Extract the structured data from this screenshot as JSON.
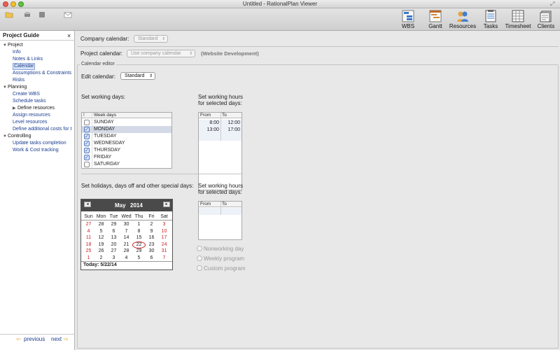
{
  "window": {
    "title": "Untitled - RationalPlan Viewer"
  },
  "colors": {
    "accent_red": "#c81e1e",
    "link_blue": "#1a3d8f",
    "check_blue": "#1b4fb6",
    "calendar_header": "#4a4a4a"
  },
  "toolbar": {
    "small_icons": [
      "folder-open-icon",
      "print-icon",
      "settings-icon",
      "email-icon"
    ],
    "views": [
      {
        "label": "WBS",
        "icon": "wbs-icon"
      },
      {
        "label": "Gantt",
        "icon": "gantt-icon"
      },
      {
        "label": "Resources",
        "icon": "resources-icon"
      },
      {
        "label": "Tasks",
        "icon": "tasks-icon"
      },
      {
        "label": "Timesheet",
        "icon": "timesheet-icon"
      },
      {
        "label": "Clients",
        "icon": "clients-icon"
      }
    ]
  },
  "guide": {
    "title": "Project Guide",
    "close": "×",
    "items": [
      {
        "label": "Project",
        "kind": "group",
        "expanded": true
      },
      {
        "label": "Info",
        "kind": "link"
      },
      {
        "label": "Notes & Links",
        "kind": "link"
      },
      {
        "label": "Calendar",
        "kind": "link",
        "selected": true
      },
      {
        "label": "Assumptions & Constraints",
        "kind": "link"
      },
      {
        "label": "Risks",
        "kind": "link"
      },
      {
        "label": "Planning",
        "kind": "group",
        "expanded": true
      },
      {
        "label": "Create WBS",
        "kind": "link"
      },
      {
        "label": "Schedule tasks",
        "kind": "link"
      },
      {
        "label": "Define resources",
        "kind": "subgroup",
        "expanded": false
      },
      {
        "label": "Assign resources",
        "kind": "link"
      },
      {
        "label": "Level resources",
        "kind": "link"
      },
      {
        "label": "Define additional costs for t",
        "kind": "link"
      },
      {
        "label": "Controlling",
        "kind": "group",
        "expanded": true
      },
      {
        "label": "Update tasks completion",
        "kind": "link"
      },
      {
        "label": "Work & Cost tracking",
        "kind": "link"
      }
    ],
    "previous": "previous",
    "next": "next"
  },
  "company_calendar": {
    "label": "Company calendar:",
    "value": "Standard"
  },
  "project_calendar": {
    "label": "Project calendar:",
    "value": "Use company calendar",
    "project_name": "(Website Development)"
  },
  "editor": {
    "group_label": "Calendar editor",
    "edit_label": "Edit calendar:",
    "edit_value": "Standard",
    "working_days_label": "Set working days:",
    "hours_label_1": "Set working hours",
    "hours_label_2": "for selected days:",
    "week_header_check": "!",
    "week_header_days": "Week days",
    "days": [
      {
        "name": "SUNDAY",
        "checked": false
      },
      {
        "name": "MONDAY",
        "checked": true,
        "selected": true
      },
      {
        "name": "TUESDAY",
        "checked": true
      },
      {
        "name": "WEDNESDAY",
        "checked": true
      },
      {
        "name": "THURSDAY",
        "checked": true
      },
      {
        "name": "FRIDAY",
        "checked": true
      },
      {
        "name": "SATURDAY",
        "checked": false
      }
    ],
    "hours_header_from": "From",
    "hours_header_to": "To",
    "hours": [
      {
        "from": "8:00",
        "to": "12:00"
      },
      {
        "from": "13:00",
        "to": "17:00"
      }
    ],
    "holidays_label": "Set holidays, days off and other special days:",
    "special_hours_label_1": "Set working hours",
    "special_hours_label_2": "for selected days:",
    "options": [
      "Nonworking day",
      "Weekly program",
      "Custom program"
    ]
  },
  "calendar": {
    "prev": "◂",
    "next": "▸",
    "month": "May",
    "year": "2014",
    "weekdays": [
      "Sun",
      "Mon",
      "Tue",
      "Wed",
      "Thu",
      "Fri",
      "Sat"
    ],
    "weeks": [
      [
        "27",
        "28",
        "29",
        "30",
        "1",
        "2",
        "3"
      ],
      [
        "4",
        "5",
        "6",
        "7",
        "8",
        "9",
        "10"
      ],
      [
        "11",
        "12",
        "13",
        "14",
        "15",
        "16",
        "17"
      ],
      [
        "18",
        "19",
        "20",
        "21",
        "22",
        "23",
        "24"
      ],
      [
        "25",
        "26",
        "27",
        "28",
        "29",
        "30",
        "31"
      ],
      [
        "1",
        "2",
        "3",
        "4",
        "5",
        "6",
        "7"
      ]
    ],
    "today_day": "22",
    "today_label": "Today: 5/22/14"
  }
}
